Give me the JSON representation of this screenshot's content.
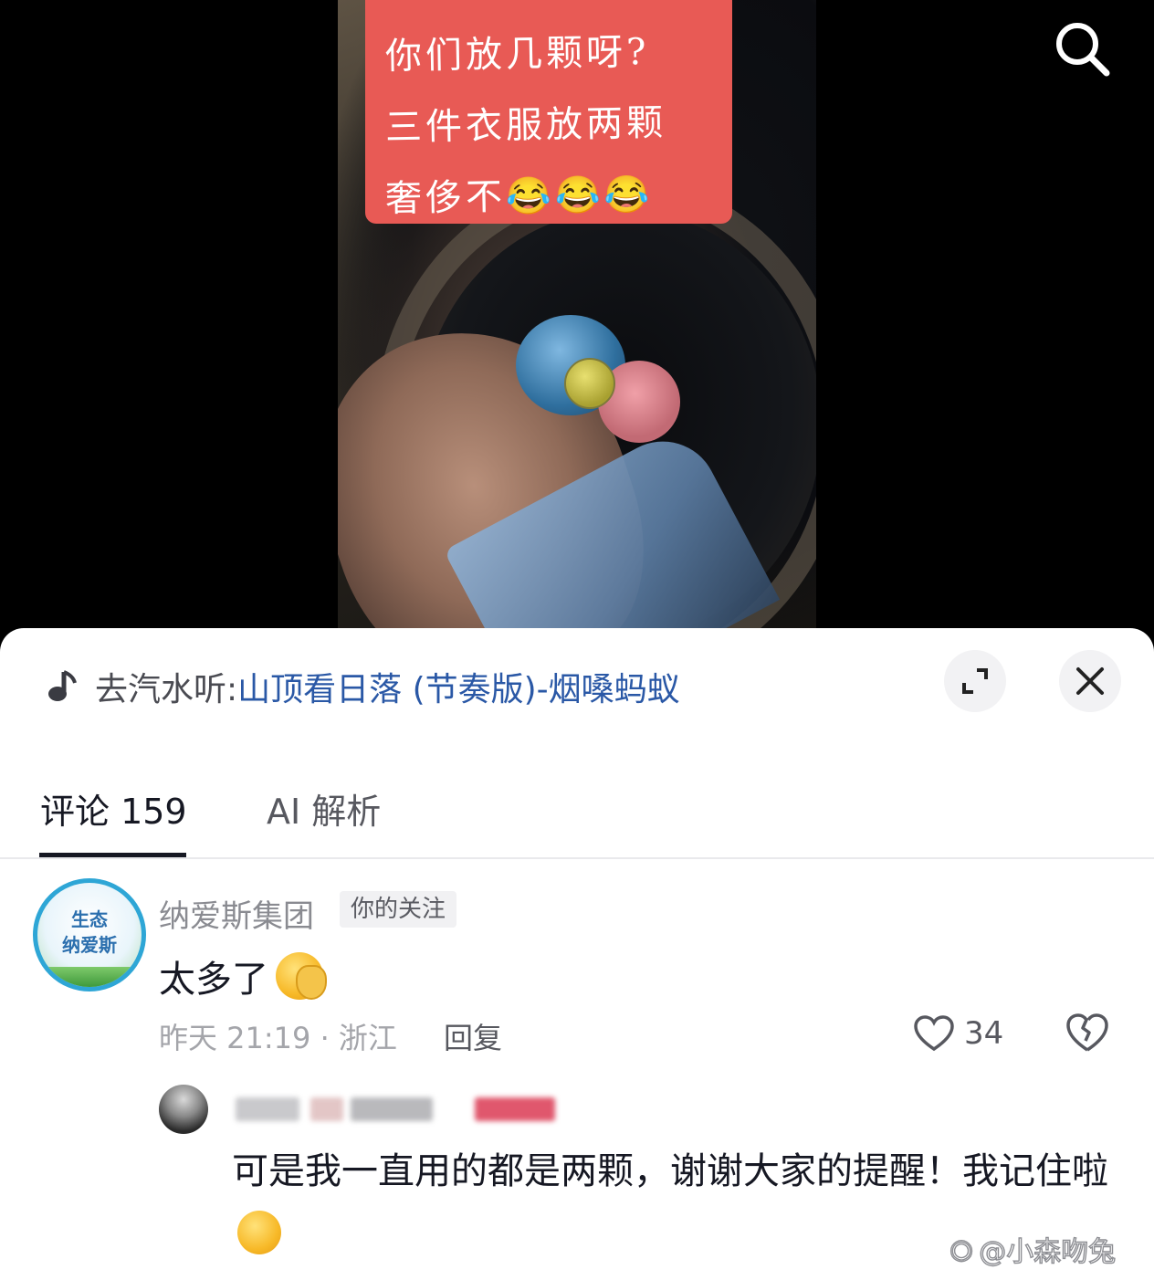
{
  "video": {
    "caption_lines": [
      "你们放几颗呀?",
      "三件衣服放两颗",
      "奢侈不😂😂😂"
    ]
  },
  "icons": {
    "search": "search-icon",
    "music": "music-note-icon",
    "expand": "expand-icon",
    "close": "close-icon",
    "like": "heart-icon",
    "dislike": "broken-heart-icon"
  },
  "sheet": {
    "music_prefix": "去汽水听:",
    "music_title": "山顶看日落 (节奏版)-烟嗓蚂蚁",
    "tabs": [
      {
        "label": "评论 159",
        "active": true
      },
      {
        "label": "AI 解析",
        "active": false
      }
    ]
  },
  "comment": {
    "avatar_text": [
      "生态",
      "纳爱斯"
    ],
    "username": "纳爱斯集团",
    "badge": "你的关注",
    "text": "太多了",
    "meta": "昨天 21:19 · 浙江",
    "reply_label": "回复",
    "likes": "34"
  },
  "reply": {
    "text": "可是我一直用的都是两颗，谢谢大家的提醒！我记住啦"
  },
  "watermark": "@小森吻兔",
  "colors": {
    "caption_bg": "#e85a55",
    "link_blue": "#2a58a6",
    "avatar_ring": "#2ea6d6"
  }
}
